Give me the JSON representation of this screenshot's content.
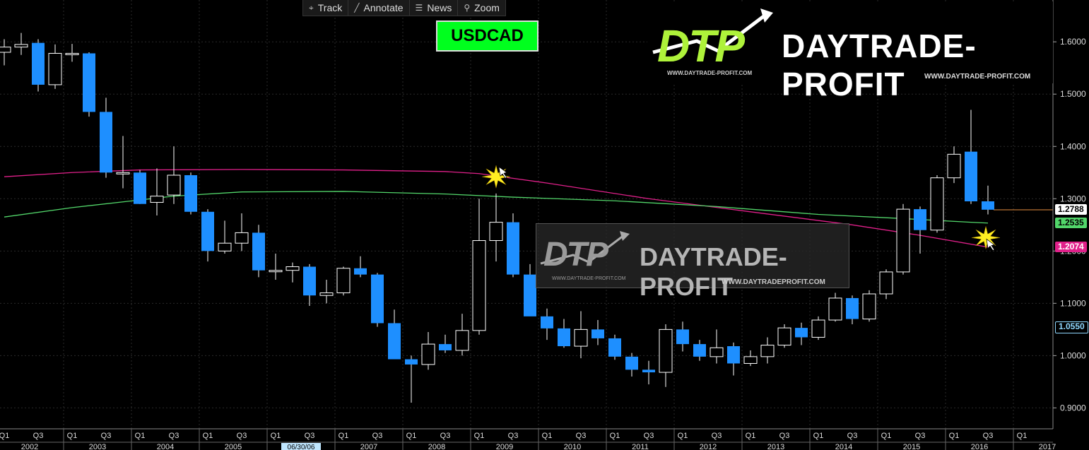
{
  "toolbar": {
    "track_label": "Track",
    "annotate_label": "Annotate",
    "news_label": "News",
    "zoom_label": "Zoom"
  },
  "ticker": "USDCAD",
  "watermark": {
    "logo_text": "DTP",
    "brand": "DAYTRADE-PROFIT",
    "url_small_top": "WWW.DAYTRADE-PROFIT.COM",
    "url_large_top": "WWW.DAYTRADE-PROFIT.COM",
    "url_small_mid": "WWW.DAYTRADE-PROFIT.COM",
    "url_large_mid": "WWW.DAYTRADEPROFIT.COM"
  },
  "price_labels": {
    "last": "1.2788",
    "ma_green": "1.2535",
    "ma_magenta": "1.2074",
    "marker": "1.0550"
  },
  "colors": {
    "bear": "#1e8fff",
    "bull_outline": "#ffffff",
    "ma_green": "#52d66a",
    "ma_magenta": "#e0208a",
    "last_line": "#e89040",
    "grid": "#2a2a2a",
    "highlight": "#ffee22"
  },
  "chart_data": {
    "type": "candlestick",
    "period": "quarterly",
    "start": "2002 Q1",
    "y_ticks": [
      "0.9000",
      "1.0000",
      "1.1000",
      "1.2000",
      "1.3000",
      "1.4000",
      "1.5000",
      "1.6000"
    ],
    "ylim": [
      0.86,
      1.68
    ],
    "x_years": [
      "2002",
      "2003",
      "2004",
      "2005",
      "06/30/06",
      "2007",
      "2008",
      "2009",
      "2010",
      "2011",
      "2012",
      "2013",
      "2014",
      "2015",
      "2016",
      "2017"
    ],
    "x_quarter_labels": [
      "Q1",
      "Q3"
    ],
    "candles": [
      {
        "o": 1.58,
        "h": 1.605,
        "l": 1.555,
        "c": 1.59
      },
      {
        "o": 1.59,
        "h": 1.617,
        "l": 1.575,
        "c": 1.595
      },
      {
        "o": 1.598,
        "h": 1.605,
        "l": 1.505,
        "c": 1.518
      },
      {
        "o": 1.518,
        "h": 1.595,
        "l": 1.51,
        "c": 1.578
      },
      {
        "o": 1.578,
        "h": 1.596,
        "l": 1.562,
        "c": 1.578
      },
      {
        "o": 1.578,
        "h": 1.58,
        "l": 1.457,
        "c": 1.466
      },
      {
        "o": 1.466,
        "h": 1.493,
        "l": 1.34,
        "c": 1.35
      },
      {
        "o": 1.35,
        "h": 1.42,
        "l": 1.32,
        "c": 1.35
      },
      {
        "o": 1.35,
        "h": 1.355,
        "l": 1.29,
        "c": 1.29
      },
      {
        "o": 1.293,
        "h": 1.358,
        "l": 1.268,
        "c": 1.305
      },
      {
        "o": 1.307,
        "h": 1.4,
        "l": 1.29,
        "c": 1.345
      },
      {
        "o": 1.345,
        "h": 1.35,
        "l": 1.27,
        "c": 1.275
      },
      {
        "o": 1.275,
        "h": 1.28,
        "l": 1.18,
        "c": 1.2
      },
      {
        "o": 1.2,
        "h": 1.258,
        "l": 1.195,
        "c": 1.215
      },
      {
        "o": 1.215,
        "h": 1.272,
        "l": 1.2,
        "c": 1.235
      },
      {
        "o": 1.235,
        "h": 1.25,
        "l": 1.15,
        "c": 1.163
      },
      {
        "o": 1.163,
        "h": 1.195,
        "l": 1.145,
        "c": 1.163
      },
      {
        "o": 1.163,
        "h": 1.178,
        "l": 1.14,
        "c": 1.17
      },
      {
        "o": 1.17,
        "h": 1.175,
        "l": 1.095,
        "c": 1.115
      },
      {
        "o": 1.115,
        "h": 1.145,
        "l": 1.1,
        "c": 1.12
      },
      {
        "o": 1.12,
        "h": 1.17,
        "l": 1.115,
        "c": 1.167
      },
      {
        "o": 1.167,
        "h": 1.19,
        "l": 1.15,
        "c": 1.155
      },
      {
        "o": 1.155,
        "h": 1.158,
        "l": 1.055,
        "c": 1.062
      },
      {
        "o": 1.062,
        "h": 1.088,
        "l": 0.995,
        "c": 0.993
      },
      {
        "o": 0.993,
        "h": 1.0,
        "l": 0.91,
        "c": 0.983
      },
      {
        "o": 0.983,
        "h": 1.045,
        "l": 0.973,
        "c": 1.022
      },
      {
        "o": 1.022,
        "h": 1.04,
        "l": 1.005,
        "c": 1.01
      },
      {
        "o": 1.01,
        "h": 1.08,
        "l": 1.0,
        "c": 1.048
      },
      {
        "o": 1.048,
        "h": 1.3,
        "l": 1.04,
        "c": 1.22
      },
      {
        "o": 1.22,
        "h": 1.31,
        "l": 1.18,
        "c": 1.255
      },
      {
        "o": 1.255,
        "h": 1.272,
        "l": 1.15,
        "c": 1.155
      },
      {
        "o": 1.155,
        "h": 1.175,
        "l": 1.08,
        "c": 1.075
      },
      {
        "o": 1.075,
        "h": 1.09,
        "l": 1.03,
        "c": 1.052
      },
      {
        "o": 1.052,
        "h": 1.07,
        "l": 1.015,
        "c": 1.018
      },
      {
        "o": 1.018,
        "h": 1.085,
        "l": 0.995,
        "c": 1.05
      },
      {
        "o": 1.05,
        "h": 1.068,
        "l": 1.02,
        "c": 1.033
      },
      {
        "o": 1.033,
        "h": 1.04,
        "l": 0.992,
        "c": 0.998
      },
      {
        "o": 0.998,
        "h": 1.005,
        "l": 0.96,
        "c": 0.973
      },
      {
        "o": 0.973,
        "h": 0.99,
        "l": 0.945,
        "c": 0.968
      },
      {
        "o": 0.968,
        "h": 1.06,
        "l": 0.94,
        "c": 1.05
      },
      {
        "o": 1.05,
        "h": 1.065,
        "l": 1.008,
        "c": 1.022
      },
      {
        "o": 1.022,
        "h": 1.03,
        "l": 0.99,
        "c": 0.998
      },
      {
        "o": 0.998,
        "h": 1.05,
        "l": 0.985,
        "c": 1.015
      },
      {
        "o": 1.018,
        "h": 1.025,
        "l": 0.962,
        "c": 0.985
      },
      {
        "o": 0.985,
        "h": 1.01,
        "l": 0.98,
        "c": 0.998
      },
      {
        "o": 0.998,
        "h": 1.035,
        "l": 0.985,
        "c": 1.02
      },
      {
        "o": 1.02,
        "h": 1.06,
        "l": 1.015,
        "c": 1.053
      },
      {
        "o": 1.053,
        "h": 1.063,
        "l": 1.02,
        "c": 1.035
      },
      {
        "o": 1.035,
        "h": 1.075,
        "l": 1.03,
        "c": 1.068
      },
      {
        "o": 1.068,
        "h": 1.12,
        "l": 1.065,
        "c": 1.11
      },
      {
        "o": 1.11,
        "h": 1.115,
        "l": 1.06,
        "c": 1.07
      },
      {
        "o": 1.07,
        "h": 1.125,
        "l": 1.065,
        "c": 1.118
      },
      {
        "o": 1.118,
        "h": 1.165,
        "l": 1.108,
        "c": 1.16
      },
      {
        "o": 1.16,
        "h": 1.29,
        "l": 1.155,
        "c": 1.28
      },
      {
        "o": 1.28,
        "h": 1.285,
        "l": 1.195,
        "c": 1.24
      },
      {
        "o": 1.24,
        "h": 1.345,
        "l": 1.235,
        "c": 1.34
      },
      {
        "o": 1.34,
        "h": 1.4,
        "l": 1.33,
        "c": 1.385
      },
      {
        "o": 1.39,
        "h": 1.47,
        "l": 1.29,
        "c": 1.295
      },
      {
        "o": 1.295,
        "h": 1.325,
        "l": 1.27,
        "c": 1.279
      }
    ],
    "ma_green": [
      [
        0,
        1.265
      ],
      [
        4,
        1.283
      ],
      [
        7,
        1.294
      ],
      [
        10,
        1.305
      ],
      [
        14,
        1.313
      ],
      [
        20,
        1.314
      ],
      [
        26,
        1.309
      ],
      [
        30,
        1.303
      ],
      [
        36,
        1.296
      ],
      [
        42,
        1.285
      ],
      [
        48,
        1.27
      ],
      [
        53,
        1.262
      ],
      [
        57,
        1.255
      ],
      [
        58,
        1.2535
      ]
    ],
    "ma_magenta": [
      [
        0,
        1.342
      ],
      [
        4,
        1.35
      ],
      [
        8,
        1.355
      ],
      [
        14,
        1.356
      ],
      [
        20,
        1.355
      ],
      [
        26,
        1.352
      ],
      [
        28,
        1.348
      ],
      [
        32,
        1.33
      ],
      [
        38,
        1.3
      ],
      [
        44,
        1.275
      ],
      [
        50,
        1.25
      ],
      [
        54,
        1.23
      ],
      [
        58,
        1.2074
      ]
    ],
    "last_price": 1.2788
  }
}
